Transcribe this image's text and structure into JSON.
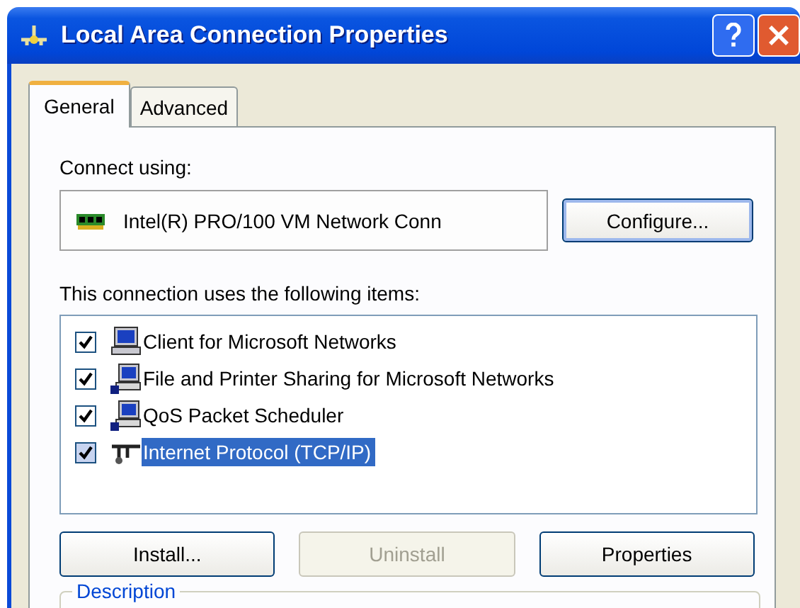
{
  "window": {
    "title": "Local Area Connection Properties"
  },
  "tabs": [
    {
      "label": "General",
      "selected": true
    },
    {
      "label": "Advanced",
      "selected": false
    }
  ],
  "connect_using": {
    "label": "Connect using:",
    "adapter": "Intel(R) PRO/100 VM Network Conn",
    "button": "Configure..."
  },
  "items_label": "This connection uses the following items:",
  "items": [
    {
      "kind": "client",
      "label": "Client for Microsoft Networks",
      "checked": true,
      "selected": false
    },
    {
      "kind": "service",
      "label": "File and Printer Sharing for Microsoft Networks",
      "checked": true,
      "selected": false
    },
    {
      "kind": "service",
      "label": "QoS Packet Scheduler",
      "checked": true,
      "selected": false
    },
    {
      "kind": "protocol",
      "label": "Internet Protocol (TCP/IP)",
      "checked": true,
      "selected": true
    }
  ],
  "buttons": [
    {
      "label": "Install...",
      "disabled": false
    },
    {
      "label": "Uninstall",
      "disabled": true
    },
    {
      "label": "Properties",
      "disabled": false
    }
  ],
  "description": {
    "legend": "Description"
  }
}
